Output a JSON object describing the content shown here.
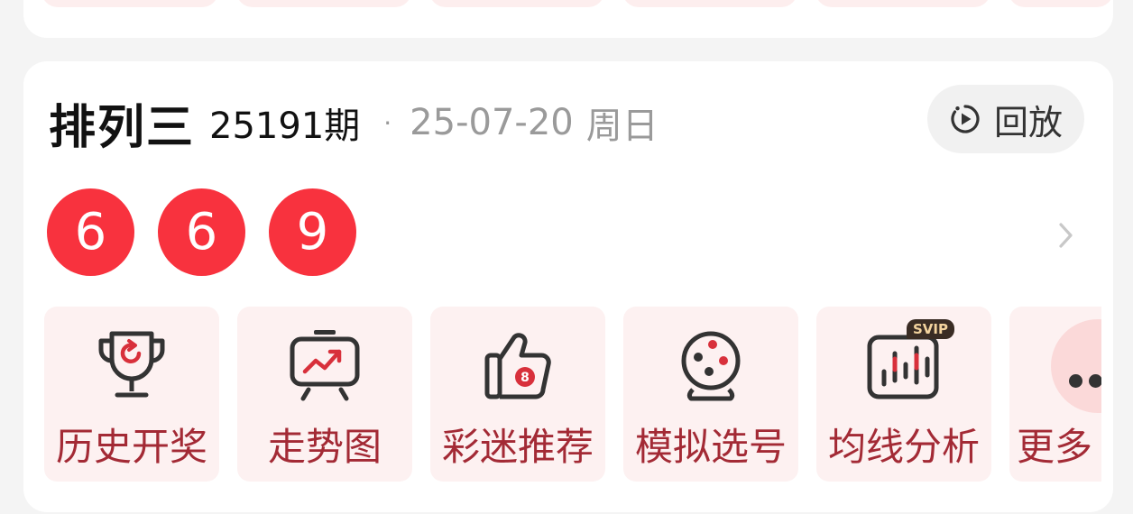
{
  "draw": {
    "lottery_name": "排列三",
    "period": "25191期",
    "separator": "·",
    "date": "25-07-20",
    "weekday": "周日",
    "balls": [
      "6",
      "6",
      "9"
    ]
  },
  "replay": {
    "label": "回放"
  },
  "tools": [
    {
      "label": "历史开奖",
      "icon": "trophy-icon"
    },
    {
      "label": "走势图",
      "icon": "trend-chart-icon"
    },
    {
      "label": "彩迷推荐",
      "icon": "thumbs-up-icon"
    },
    {
      "label": "模拟选号",
      "icon": "lottery-machine-icon"
    },
    {
      "label": "均线分析",
      "icon": "candlestick-icon",
      "badge": "SVIP"
    },
    {
      "label": "更多",
      "icon": "more-icon"
    }
  ],
  "colors": {
    "ball": "#f8323e",
    "tool_bg": "#fdf1f1",
    "tool_label": "#a32a35",
    "icon_stroke": "#333333",
    "icon_accent": "#d8303b"
  }
}
